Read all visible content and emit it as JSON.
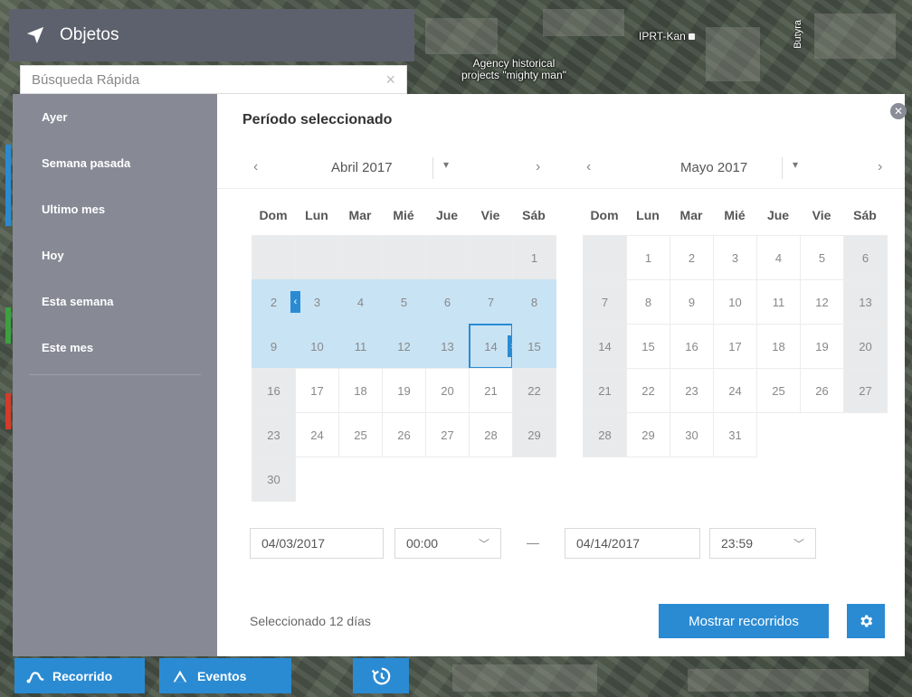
{
  "map": {
    "labels": {
      "place1": "IPRT-Kan",
      "place2_line1": "Agency historical",
      "place2_line2": "projects \"mighty man\"",
      "street": "Butyra"
    }
  },
  "objects_panel": {
    "title": "Objetos",
    "search_placeholder": "Búsqueda Rápida"
  },
  "quick_periods": [
    "Ayer",
    "Semana pasada",
    "Ultimo mes",
    "Hoy",
    "Esta semana",
    "Este mes"
  ],
  "picker": {
    "title": "Período seleccionado",
    "calendars": [
      {
        "month_label": "Abril 2017",
        "weekdays": [
          "Dom",
          "Lun",
          "Mar",
          "Mié",
          "Jue",
          "Vie",
          "Sáb"
        ],
        "leading_empty": 6,
        "days": 30,
        "range_start": 3,
        "range_end": 14,
        "selected": 14
      },
      {
        "month_label": "Mayo 2017",
        "weekdays": [
          "Dom",
          "Lun",
          "Mar",
          "Mié",
          "Jue",
          "Vie",
          "Sáb"
        ],
        "leading_empty": 1,
        "days": 31,
        "range_start": null,
        "range_end": null,
        "selected": null
      }
    ],
    "from_date": "04/03/2017",
    "from_time": "00:00",
    "to_date": "04/14/2017",
    "to_time": "23:59",
    "selected_text": "Seleccionado 12 días",
    "show_button": "Mostrar recorridos"
  },
  "bottom_buttons": {
    "route": "Recorrido",
    "events": "Eventos"
  },
  "colors": {
    "accent": "#2a8bd3",
    "range": "#c8e3f4",
    "sidebar": "#878995",
    "header": "#5d616d"
  }
}
